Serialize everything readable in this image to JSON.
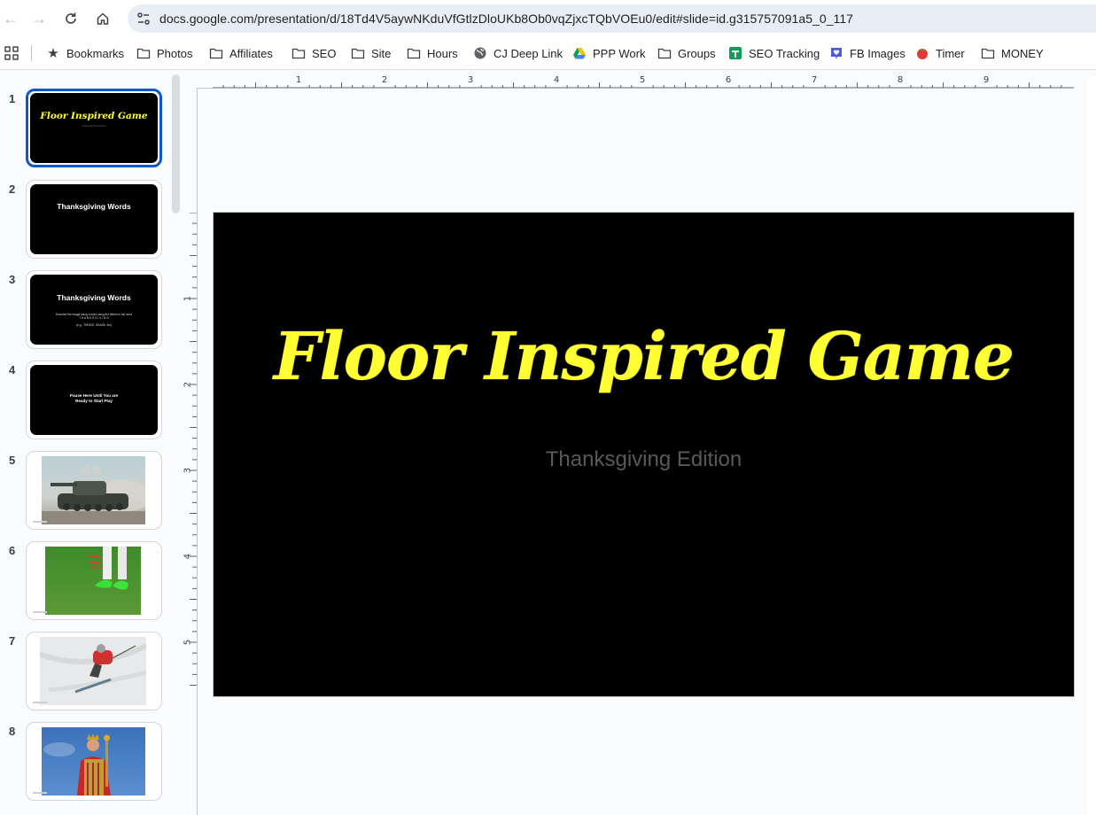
{
  "browser": {
    "url": "docs.google.com/presentation/d/18Td4V5aywNKduVfGtlzDloUKb8Ob0vqZjxcTQbVOEu0/edit#slide=id.g315757091a5_0_117",
    "nav": {
      "back_icon": "arrow-left-icon",
      "forward_icon": "arrow-right-icon",
      "reload_icon": "reload-icon",
      "home_icon": "home-icon",
      "site_info_icon": "tune-icon"
    },
    "bookmarks": [
      {
        "label": "Bookmarks",
        "icon": "star-icon"
      },
      {
        "label": "Photos",
        "icon": "folder-icon"
      },
      {
        "label": "Affiliates",
        "icon": "folder-icon"
      },
      {
        "label": "SEO",
        "icon": "folder-icon"
      },
      {
        "label": "Site",
        "icon": "folder-icon"
      },
      {
        "label": "Hours",
        "icon": "folder-icon"
      },
      {
        "label": "CJ Deep Link",
        "icon": "globe-icon"
      },
      {
        "label": "PPP Work",
        "icon": "google-drive-icon"
      },
      {
        "label": "Groups",
        "icon": "folder-icon"
      },
      {
        "label": "SEO Tracking",
        "icon": "google-sheets-icon"
      },
      {
        "label": "FB Images",
        "icon": "heart-badge-icon"
      },
      {
        "label": "Timer",
        "icon": "tomato-icon"
      },
      {
        "label": "MONEY",
        "icon": "folder-icon"
      }
    ]
  },
  "colors": {
    "selection": "#0b57d0",
    "slide_title": "#ffff33",
    "slide_subtitle": "#595959",
    "slide_background": "#000000"
  },
  "filmstrip": {
    "selected_slide": 1,
    "slides": [
      {
        "number": "1",
        "title": "Floor Inspired Game",
        "subtitle": "Thanksgiving Edition"
      },
      {
        "number": "2",
        "title": "Thanksgiving Words"
      },
      {
        "number": "3",
        "title": "Thanksgiving Words",
        "body": "Describe the image using a word using the letters in the word",
        "word": "T H A N K S G I V I N G",
        "example": "(e.g., THINGS, SHANK, etc)"
      },
      {
        "number": "4",
        "body_line1": "Pause Here Until You are",
        "body_line2": "Ready to Start Play"
      },
      {
        "number": "5",
        "image": "tank photo"
      },
      {
        "number": "6",
        "image": "soccer cleats on grass photo"
      },
      {
        "number": "7",
        "image": "skier photo"
      },
      {
        "number": "8",
        "image": "king statue photo"
      }
    ]
  },
  "rulers": {
    "horizontal_labels": [
      "1",
      "2",
      "3",
      "4",
      "5",
      "6",
      "7",
      "8",
      "9"
    ],
    "vertical_labels": [
      "1",
      "2",
      "3",
      "4",
      "5"
    ]
  },
  "slide": {
    "title": "Floor Inspired Game",
    "subtitle": "Thanksgiving Edition"
  }
}
